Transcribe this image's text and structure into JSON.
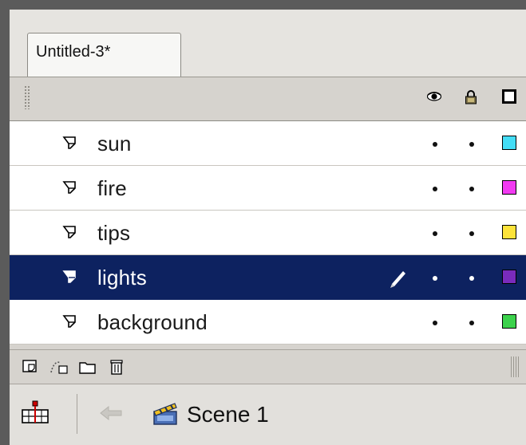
{
  "document": {
    "tab_label": "Untitled-3*"
  },
  "header": {
    "icons": [
      "eye-icon",
      "lock-icon",
      "outline-icon"
    ]
  },
  "layers": [
    {
      "name": "sun",
      "selected": false,
      "color": "#44ddf6",
      "visible_dot": "•",
      "lock_dot": "•"
    },
    {
      "name": "fire",
      "selected": false,
      "color": "#f23af2",
      "visible_dot": "•",
      "lock_dot": "•"
    },
    {
      "name": "tips",
      "selected": false,
      "color": "#fde33a",
      "visible_dot": "•",
      "lock_dot": "•"
    },
    {
      "name": "lights",
      "selected": true,
      "color": "#7a2bbc",
      "visible_dot": "•",
      "lock_dot": "•",
      "editing_icon": "pencil-icon"
    },
    {
      "name": "background",
      "selected": false,
      "color": "#3cd24c",
      "visible_dot": "•",
      "lock_dot": "•"
    }
  ],
  "toolbar": {
    "buttons": [
      "new-layer-icon",
      "motion-guide-icon",
      "new-folder-icon",
      "trash-icon"
    ]
  },
  "scene": {
    "label": "Scene 1",
    "icons": [
      "timeline-icon",
      "back-arrow-icon",
      "clapperboard-icon"
    ]
  },
  "colors": {
    "selection": "#0d2260",
    "panel": "#d6d3ce"
  }
}
